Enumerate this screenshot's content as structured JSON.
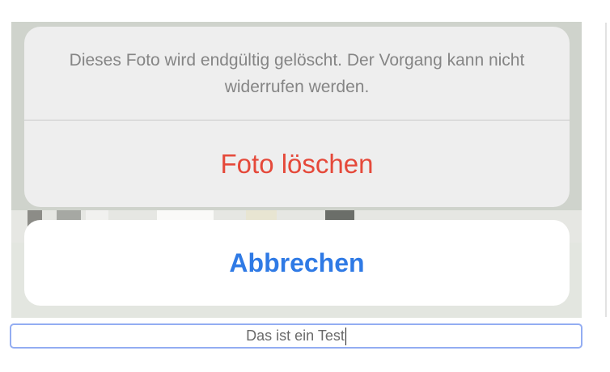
{
  "action_sheet": {
    "message": "Dieses Foto wird endgültig gelöscht. Der Vorgang kann nicht widerrufen werden.",
    "destructive_label": "Foto löschen",
    "cancel_label": "Abbrechen"
  },
  "caption": {
    "value": "Das ist ein Test"
  },
  "colors": {
    "destructive": "#e5493a",
    "cancel": "#2f7ae5",
    "focus_ring": "#93adf2"
  }
}
